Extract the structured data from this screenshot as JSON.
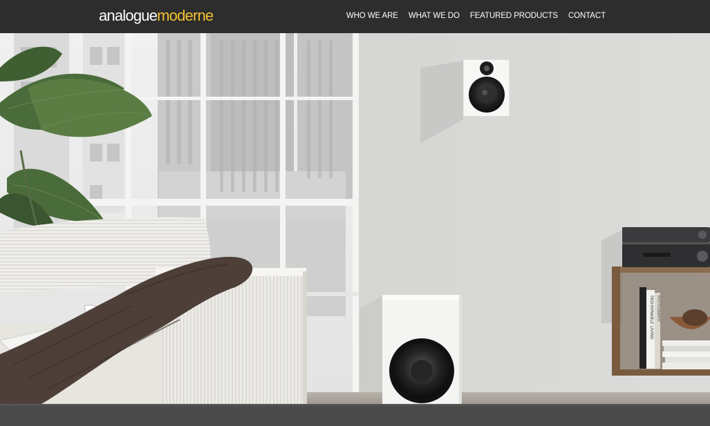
{
  "brand": {
    "logo_part1": "analogue",
    "logo_part2": "moderne"
  },
  "nav": {
    "items": [
      {
        "label": "WHO WE ARE"
      },
      {
        "label": "WHAT WE DO"
      },
      {
        "label": "FEATURED PRODUCTS"
      },
      {
        "label": "CONTACT"
      }
    ]
  },
  "hero": {
    "book_spine_1": "FASHIONABLE LIVING",
    "book_spine_2": "PHOTOGRAPHY"
  },
  "colors": {
    "header_bg": "#2d2d2d",
    "logo_accent": "#f2c230",
    "nav_text": "#ffffff",
    "wall": "#d6d6d4",
    "bottom_band": "#4a4a4a"
  },
  "icons": [
    "bookshelf-speaker",
    "subwoofer",
    "amplifier"
  ]
}
